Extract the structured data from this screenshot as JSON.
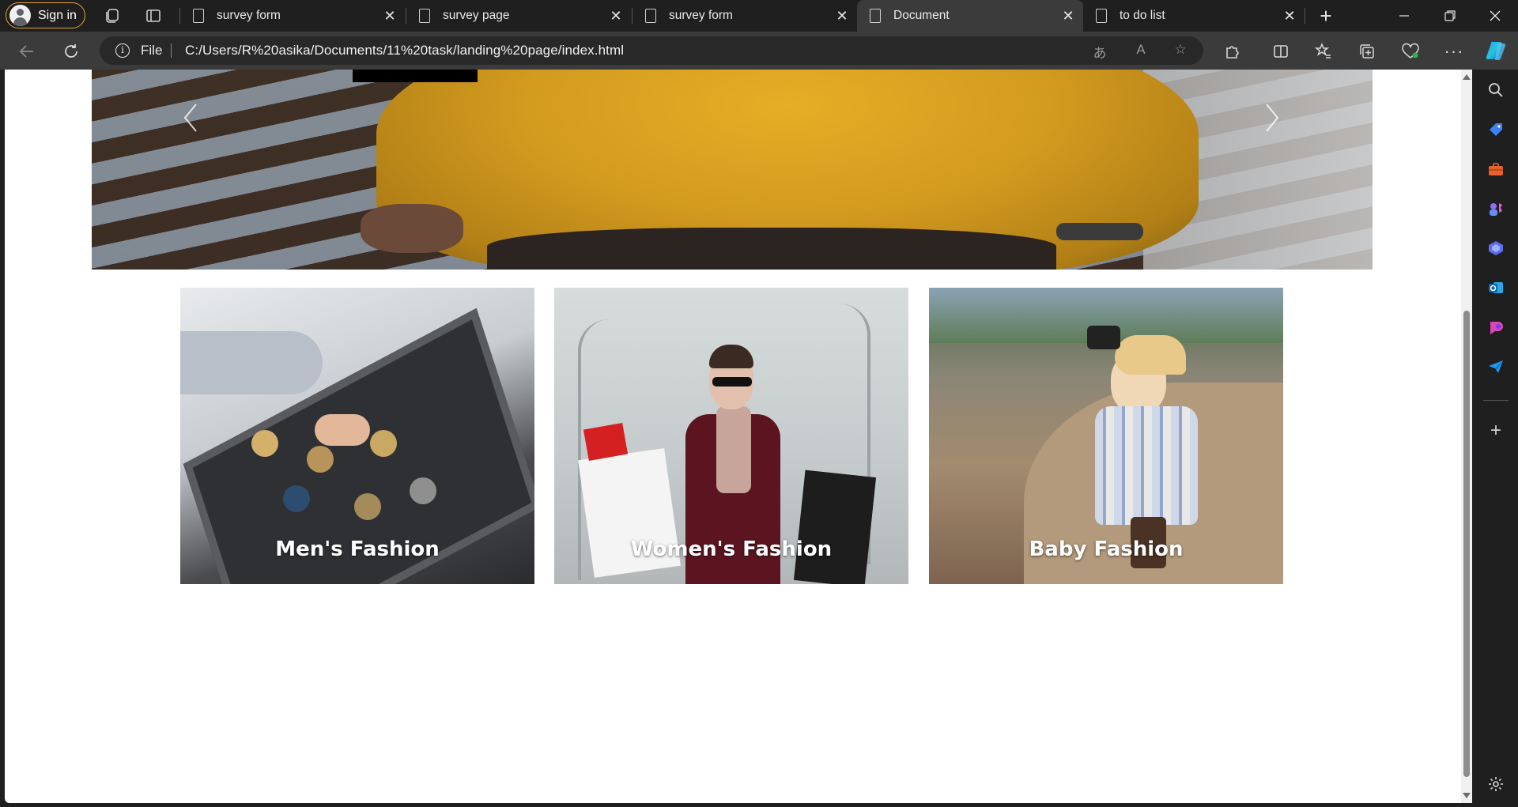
{
  "browser": {
    "signin_label": "Sign in",
    "tabs": [
      {
        "title": "survey form",
        "active": false
      },
      {
        "title": "survey page",
        "active": false
      },
      {
        "title": "survey form",
        "active": false
      },
      {
        "title": "Document",
        "active": true
      },
      {
        "title": "to do list",
        "active": false
      }
    ],
    "address": {
      "scheme_label": "File",
      "url": "C:/Users/R%20asika/Documents/11%20task/landing%20page/index.html"
    }
  },
  "page": {
    "hero": {
      "prev_icon": "chevron-left-icon",
      "next_icon": "chevron-right-icon"
    },
    "categories": [
      {
        "label": "Men's Fashion"
      },
      {
        "label": "Women's Fashion"
      },
      {
        "label": "Baby Fashion"
      }
    ]
  },
  "colors": {
    "signin_border": "#e8a33a",
    "active_tab": "#3b3b3b",
    "frame": "#1f1f1f"
  }
}
